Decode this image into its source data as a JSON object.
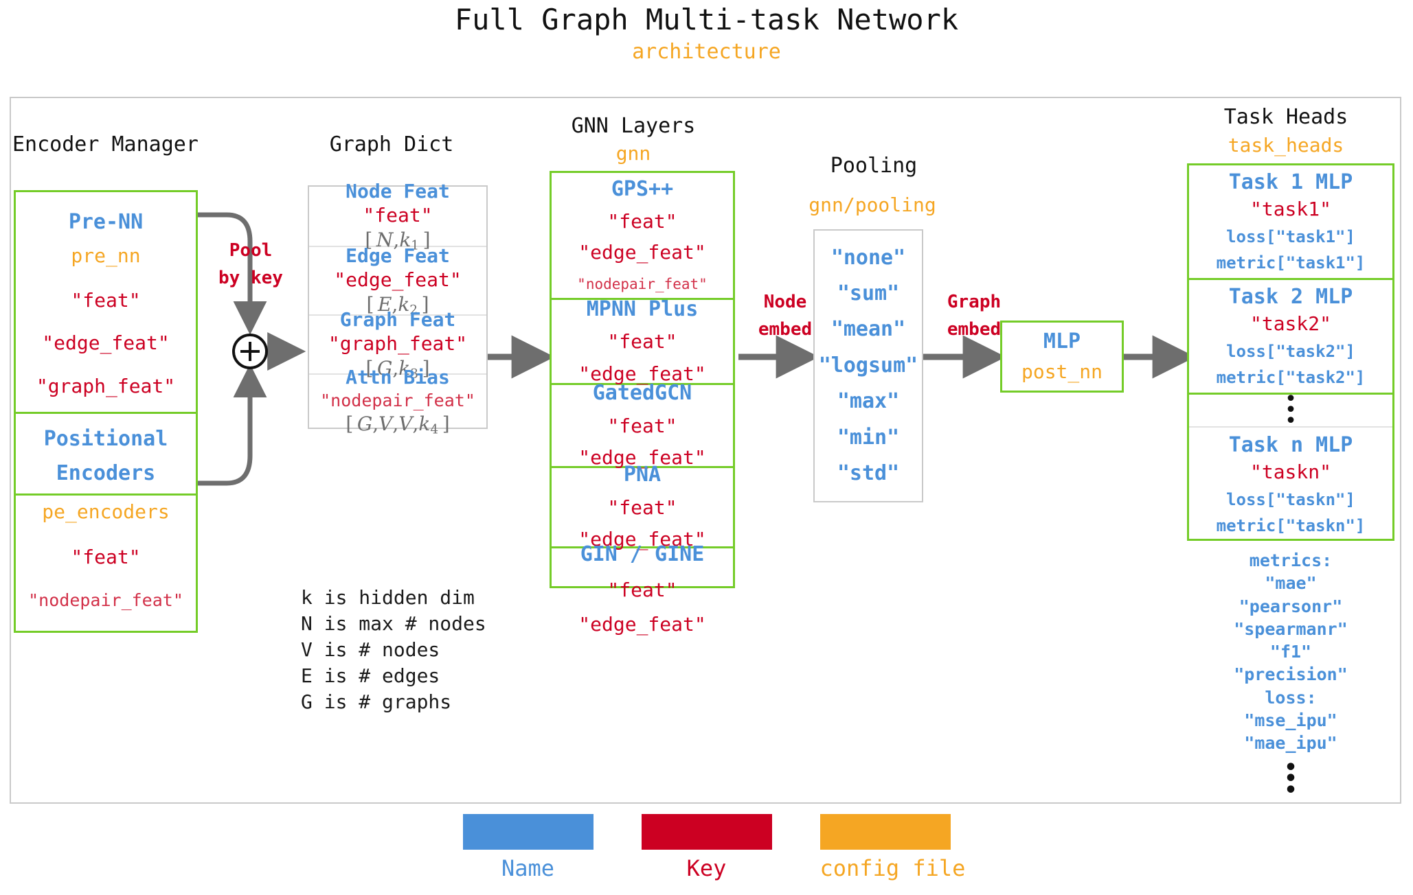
{
  "title": "Full Graph Multi-task Network",
  "subtitle": "architecture",
  "colors": {
    "name_blue": "#4A90D9",
    "key_red": "#CC0022",
    "config_orange": "#F5A623",
    "box_green": "#74CC28",
    "box_grey": "#C9C9C9",
    "arrow_grey": "#6E6E6E"
  },
  "encoder_manager": {
    "heading": "Encoder Manager",
    "blocks": [
      {
        "name": "Pre-NN",
        "config": "pre_nn",
        "keys": [
          "\"feat\"",
          "\"edge_feat\"",
          "\"graph_feat\""
        ]
      },
      {
        "name_line1": "Positional",
        "name_line2": "Encoders",
        "config": "pe_encoders",
        "keys": [
          "\"feat\"",
          "\"nodepair_feat\""
        ]
      }
    ],
    "pool_label_line1": "Pool",
    "pool_label_line2": "by key",
    "sum_symbol": "+"
  },
  "graph_dict": {
    "heading": "Graph Dict",
    "rows": [
      {
        "name": "Node Feat",
        "key": "\"feat\"",
        "dim": [
          "N",
          "k",
          "1"
        ],
        "dim_extra": []
      },
      {
        "name": "Edge Feat",
        "key": "\"edge_feat\"",
        "dim": [
          "E",
          "k",
          "2"
        ],
        "dim_extra": []
      },
      {
        "name": "Graph Feat",
        "key": "\"graph_feat\"",
        "dim": [
          "G",
          "k",
          "3"
        ],
        "dim_extra": []
      },
      {
        "name": "Attn Bias",
        "key": "\"nodepair_feat\"",
        "dim": [
          "G",
          "k",
          "4"
        ],
        "dim_extra": [
          "V",
          "V"
        ]
      }
    ],
    "legend": "k is hidden dim\nN is max # nodes\nV is # nodes\nE is # edges\nG is # graphs"
  },
  "gnn_layers": {
    "heading": "GNN Layers",
    "config": "gnn",
    "layers": [
      {
        "name": "GPS++",
        "keys": [
          "\"feat\"",
          "\"edge_feat\""
        ],
        "small_key": "\"nodepair_feat\""
      },
      {
        "name": "MPNN Plus",
        "keys": [
          "\"feat\"",
          "\"edge_feat\""
        ],
        "small_key": ""
      },
      {
        "name": "GatedGCN",
        "keys": [
          "\"feat\"",
          "\"edge_feat\""
        ],
        "small_key": ""
      },
      {
        "name": "PNA",
        "keys": [
          "\"feat\"",
          "\"edge_feat\""
        ],
        "small_key": ""
      },
      {
        "name": "GIN / GINE",
        "keys": [
          "\"feat\"",
          "\"edge_feat\""
        ],
        "small_key": ""
      }
    ]
  },
  "pooling": {
    "heading": "Pooling",
    "config": "gnn/pooling",
    "options": [
      "\"none\"",
      "\"sum\"",
      "\"mean\"",
      "\"logsum\"",
      "\"max\"",
      "\"min\"",
      "\"std\""
    ]
  },
  "post_mlp": {
    "name": "MLP",
    "config": "post_nn"
  },
  "task_heads": {
    "heading": "Task Heads",
    "config": "task_heads",
    "heads": [
      {
        "name": "Task 1 MLP",
        "key": "\"task1\"",
        "loss": "loss[\"task1\"]",
        "metric": "metric[\"task1\"]"
      },
      {
        "name": "Task 2 MLP",
        "key": "\"task2\"",
        "loss": "loss[\"task2\"]",
        "metric": "metric[\"task2\"]"
      },
      {
        "name": "Task n MLP",
        "key": "\"taskn\"",
        "loss": "loss[\"taskn\"]",
        "metric": "metric[\"taskn\"]"
      }
    ],
    "metrics_block": [
      "metrics:",
      "\"mae\"",
      "\"pearsonr\"",
      "\"spearmanr\"",
      "\"f1\"",
      "\"precision\"",
      "loss:",
      "\"mse_ipu\"",
      "\"mae_ipu\""
    ]
  },
  "arrows": {
    "node_embed_line1": "Node",
    "node_embed_line2": "embed",
    "graph_embed_line1": "Graph",
    "graph_embed_line2": "embed"
  },
  "legend": {
    "items": [
      {
        "label": "Name",
        "color": "#4A90D9"
      },
      {
        "label": "Key",
        "color": "#CC0022"
      },
      {
        "label": "config file",
        "color": "#F5A623"
      }
    ]
  }
}
